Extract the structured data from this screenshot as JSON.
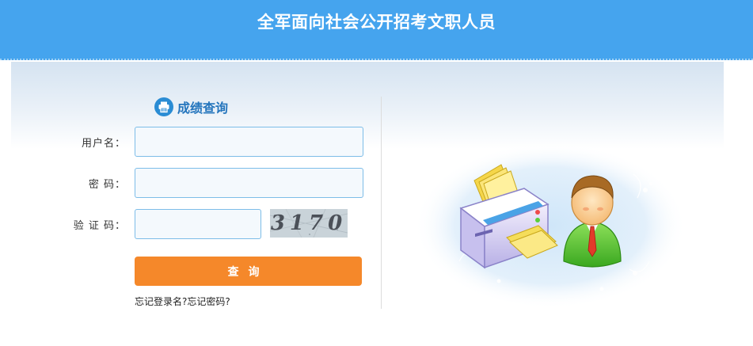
{
  "header": {
    "title": "全军面向社会公开招考文职人员"
  },
  "form": {
    "title": "成绩查询",
    "title_icon": "printer-icon",
    "username_label": "用户名：",
    "password_label": "密  码：",
    "captcha_label": "验 证 码：",
    "username_value": "",
    "password_value": "",
    "captcha_value": "",
    "captcha_image_text": "3170",
    "submit_label": "查询",
    "forgot_username": "忘记登录名?",
    "forgot_password": "忘记密码?"
  },
  "colors": {
    "header_bg": "#45a4ee",
    "title_blue": "#2475bd",
    "button_orange": "#f5882a",
    "input_border": "#7dbde8"
  }
}
